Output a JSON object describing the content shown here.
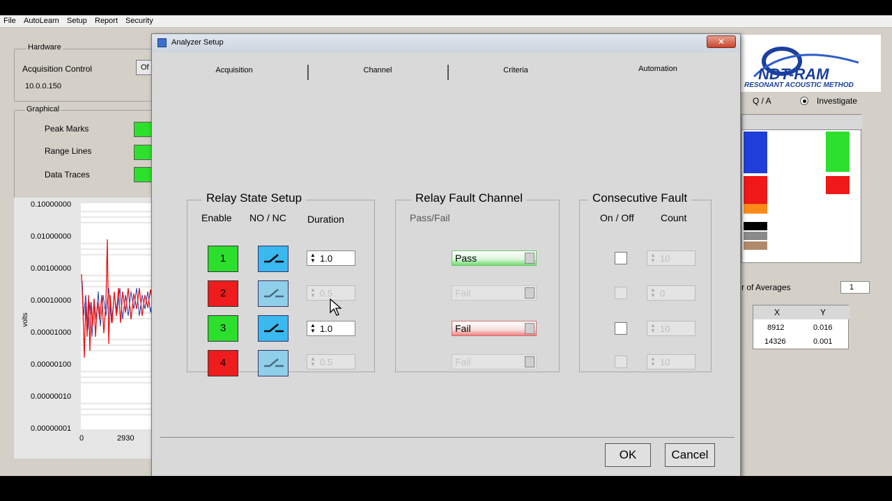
{
  "menu": [
    "File",
    "AutoLearn",
    "Setup",
    "Report",
    "Security"
  ],
  "background": {
    "hardware_group": "Hardware",
    "acquisition_control": "Acquisition Control",
    "ip_address": "10.0.0.150",
    "acq_button": "Of",
    "graphical_group": "Graphical",
    "peak_marks": "Peak Marks",
    "range_lines": "Range Lines",
    "data_traces": "Data Traces",
    "toggle_text": "Of",
    "y_axis_label": "volts",
    "y_ticks": [
      "0.10000000",
      "0.01000000",
      "0.00100000",
      "0.00010000",
      "0.00001000",
      "0.00000100",
      "0.00000010",
      "0.00000001"
    ],
    "x_ticks": [
      "0",
      "2930"
    ],
    "logo_text": "NDT-RAM",
    "logo_sub": "RESONANT ACOUSTIC METHOD",
    "qa_label": "Q / A",
    "investigate_label": "Investigate",
    "averages_label": "r of Averages",
    "averages_value": "1",
    "xy_headers": [
      "X",
      "Y"
    ],
    "xy_rows": [
      [
        "8912",
        "0.016"
      ],
      [
        "14326",
        "0.001"
      ]
    ]
  },
  "dialog": {
    "title": "Analyzer Setup",
    "close": "✕",
    "tabs": [
      "Acquisition",
      "Channel",
      "Criteria",
      "Automation"
    ],
    "relay_state": {
      "title": "Relay State Setup",
      "col_enable": "Enable",
      "col_nonc": "NO / NC",
      "col_duration": "Duration",
      "rows": [
        {
          "label": "1",
          "duration": "1.0"
        },
        {
          "label": "2",
          "duration": "0.5"
        },
        {
          "label": "3",
          "duration": "1.0"
        },
        {
          "label": "4",
          "duration": "0.5"
        }
      ]
    },
    "relay_fault": {
      "title": "Relay Fault Channel",
      "col_passfail": "Pass/Fail",
      "rows": [
        "Pass",
        "Fail",
        "Fail",
        "Fail"
      ]
    },
    "consecutive": {
      "title": "Consecutive Fault",
      "col_onoff": "On / Off",
      "col_count": "Count",
      "counts": [
        "10",
        "0",
        "10",
        "10"
      ]
    },
    "ok": "OK",
    "cancel": "Cancel"
  }
}
